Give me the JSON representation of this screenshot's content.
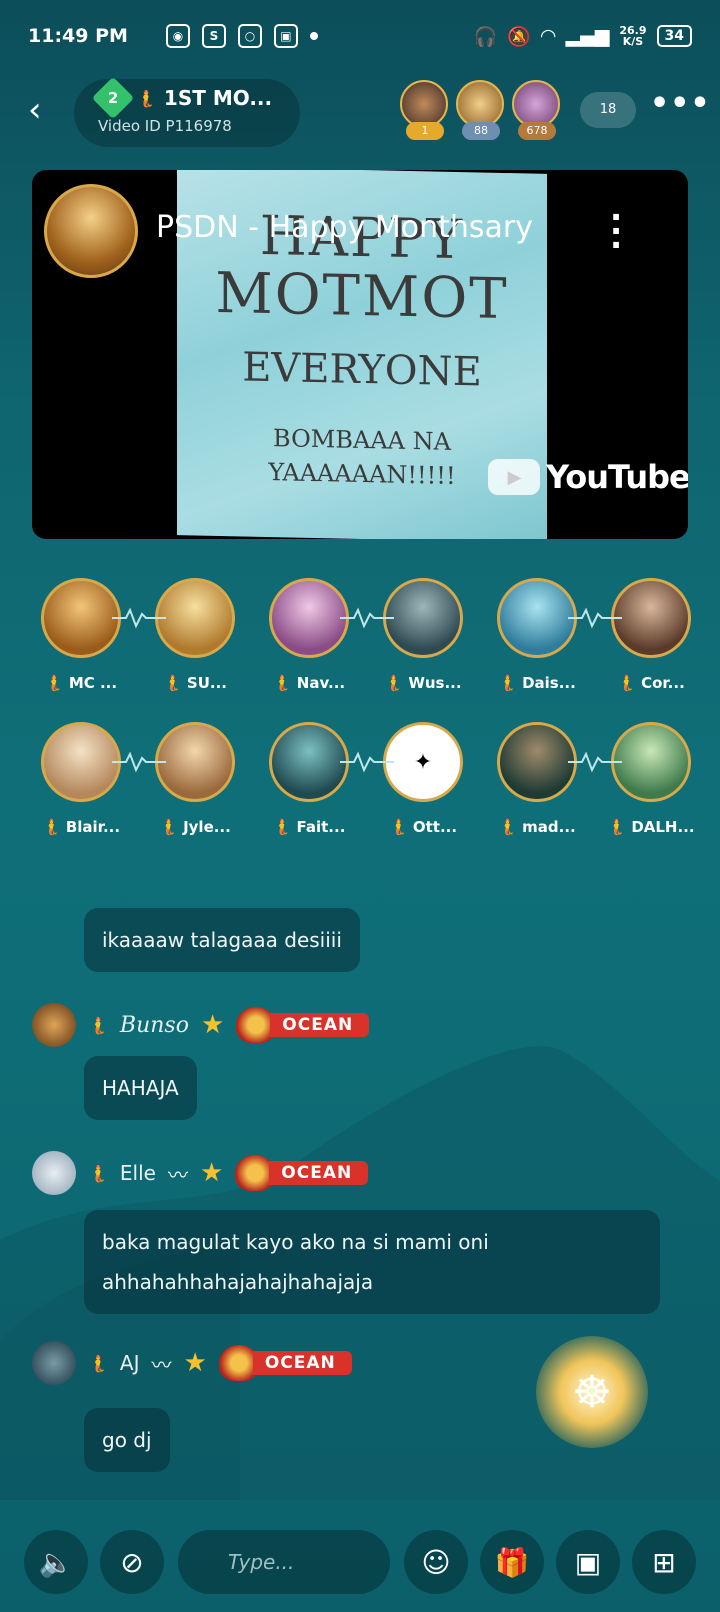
{
  "status_bar": {
    "time": "11:49 PM",
    "net_speed_value": "26.9",
    "net_speed_unit": "K/S",
    "battery": "34"
  },
  "header": {
    "level": "2",
    "room_name": "1ST MO...",
    "room_id": "Video ID P116978",
    "top_users": [
      {
        "tag": "1",
        "tag_color": "#e6a92b"
      },
      {
        "tag": "88",
        "tag_color": "#6f8fb0"
      },
      {
        "tag": "678",
        "tag_color": "#b37a3c"
      }
    ],
    "member_count": "18"
  },
  "video": {
    "title": "PSDN - Happy Monthsary",
    "frame_line1": "HAPPY",
    "frame_line2": "MOTMOT",
    "frame_line3": "EVERYONE",
    "frame_line4a": "BOMBAAA NA",
    "frame_line4b": "YAAAAAAN!!!!!",
    "platform": "YouTube"
  },
  "seats": [
    {
      "name": "MC ...",
      "color": "#d9a34a"
    },
    {
      "name": "SU...",
      "color": "#e0b86a"
    },
    {
      "name": "Nav...",
      "color": "#b57bb0"
    },
    {
      "name": "Wus...",
      "color": "#506a74"
    },
    {
      "name": "Dais...",
      "color": "#4fa9c4"
    },
    {
      "name": "Cor...",
      "color": "#8d6a4f"
    },
    {
      "name": "Blair...",
      "color": "#c89b74"
    },
    {
      "name": "Jyle...",
      "color": "#d8b07a"
    },
    {
      "name": "Fait...",
      "color": "#3d7f86"
    },
    {
      "name": "Ott...",
      "color": "#ffffff"
    },
    {
      "name": "mad...",
      "color": "#2f5f4f"
    },
    {
      "name": "DALH...",
      "color": "#5a9e6a"
    }
  ],
  "chat": {
    "msg1": "ikaaaaw talagaaa desiiii",
    "user2": "Bunso",
    "msg2": "HAHAJA",
    "user3": "Elle",
    "msg3_line1": "baka magulat kayo ako na si mami oni",
    "msg3_line2": "ahhahahhahajahajhahajaja",
    "user4": "AJ",
    "msg4": "go dj",
    "badge_label": "OCEAN"
  },
  "input": {
    "placeholder": "Type..."
  },
  "colors": {
    "accent_gold": "#d8a94a",
    "badge_red": "#d8322b",
    "level_green": "#34c16b"
  }
}
